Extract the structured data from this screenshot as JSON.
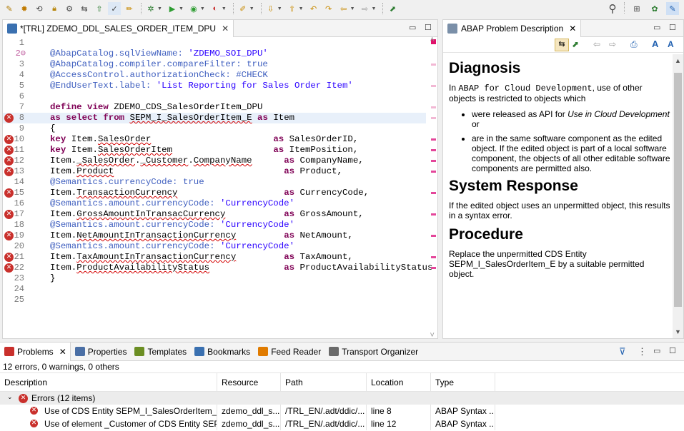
{
  "editor": {
    "tab_title": "*[TRL] ZDEMO_DDL_SALES_ORDER_ITEM_DPU",
    "lines": [
      {
        "n": "1",
        "text": ""
      },
      {
        "n": "2",
        "text": "@AbapCatalog.sqlViewName: 'ZDEMO_SOI_DPU'"
      },
      {
        "n": "3",
        "text": "@AbapCatalog.compiler.compareFilter: true"
      },
      {
        "n": "4",
        "text": "@AccessControl.authorizationCheck: #CHECK"
      },
      {
        "n": "5",
        "text": "@EndUserText.label: 'List Reporting for Sales Order Item'"
      },
      {
        "n": "6",
        "text": ""
      },
      {
        "n": "7",
        "text": "define view ZDEMO_CDS_SalesOrderItem_DPU"
      },
      {
        "n": "8",
        "text": "as select from SEPM_I_SalesOrderItem_E as Item"
      },
      {
        "n": "9",
        "text": "{"
      },
      {
        "n": "10",
        "text": "key Item.SalesOrder                       as SalesOrderID,"
      },
      {
        "n": "11",
        "text": "key Item.SalesOrderItem                   as ItemPosition,"
      },
      {
        "n": "12",
        "text": "Item._SalesOrder._Customer.CompanyName      as CompanyName,"
      },
      {
        "n": "13",
        "text": "Item.Product                                as Product,"
      },
      {
        "n": "14",
        "text": "@Semantics.currencyCode: true"
      },
      {
        "n": "15",
        "text": "Item.TransactionCurrency                    as CurrencyCode,"
      },
      {
        "n": "16",
        "text": "@Semantics.amount.currencyCode: 'CurrencyCode'"
      },
      {
        "n": "17",
        "text": "Item.GrossAmountInTransacCurrency           as GrossAmount,"
      },
      {
        "n": "18",
        "text": "@Semantics.amount.currencyCode: 'CurrencyCode'"
      },
      {
        "n": "19",
        "text": "Item.NetAmountInTransactionCurrency         as NetAmount,"
      },
      {
        "n": "20",
        "text": "@Semantics.amount.currencyCode: 'CurrencyCode'"
      },
      {
        "n": "21",
        "text": "Item.TaxAmountInTransactionCurrency         as TaxAmount,"
      },
      {
        "n": "22",
        "text": "Item.ProductAvailabilityStatus              as ProductAvailabilityStatus"
      },
      {
        "n": "23",
        "text": "}"
      },
      {
        "n": "24",
        "text": ""
      },
      {
        "n": "25",
        "text": ""
      }
    ]
  },
  "doc": {
    "tab_title": "ABAP Problem Description",
    "h_diagnosis": "Diagnosis",
    "p1_in": "In",
    "p1_mono": "ABAP for Cloud Development",
    "p1_rest": ", use of other objects is restricted to objects which",
    "li1_a": "were released as API for",
    "li1_b": "Use in Cloud Development",
    "li1_c": "or",
    "li2": "are in the same software component as the edited object. If the edited object is part of a local software component, the objects of all other editable software components are permitted also.",
    "h_response": "System Response",
    "p2": "If the edited object uses an unpermitted object, this results in a syntax error.",
    "h_procedure": "Procedure",
    "p3": "Replace the unpermitted CDS Entity SEPM_I_SalesOrderItem_E by a suitable permitted object."
  },
  "bottom": {
    "tabs": [
      "Problems",
      "Properties",
      "Templates",
      "Bookmarks",
      "Feed Reader",
      "Transport Organizer"
    ],
    "summary": "12 errors, 0 warnings, 0 others",
    "columns": [
      "Description",
      "Resource",
      "Path",
      "Location",
      "Type"
    ],
    "group": "Errors (12 items)",
    "rows": [
      [
        "Use of CDS Entity SEPM_I_SalesOrderItem_E is",
        "zdemo_ddl_s...",
        "/TRL_EN/.adt/ddic/...",
        "line 8",
        "ABAP Syntax ..."
      ],
      [
        "Use of element _Customer of CDS Entity SEPM",
        "zdemo_ddl_s...",
        "/TRL_EN/.adt/ddic/...",
        "line 12",
        "ABAP Syntax ..."
      ]
    ]
  }
}
